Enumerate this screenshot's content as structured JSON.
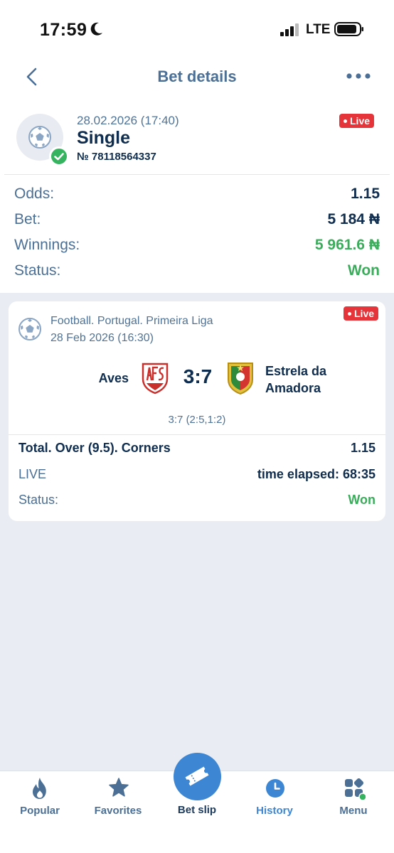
{
  "status_bar": {
    "time": "17:59",
    "network": "LTE"
  },
  "header": {
    "title": "Bet details",
    "back_icon": "chevron-left-icon",
    "more_icon": "more-dots-icon"
  },
  "bet": {
    "datetime": "28.02.2026 (17:40)",
    "type": "Single",
    "number": "№ 78118564337",
    "live_badge": "Live",
    "rows": [
      {
        "label": "Odds:",
        "value": "1.15"
      },
      {
        "label": "Bet:",
        "value": "5 184 ₦"
      },
      {
        "label": "Winnings:",
        "value": "5 961.6 ₦"
      },
      {
        "label": "Status:",
        "value": "Won"
      }
    ]
  },
  "event": {
    "league": "Football. Portugal. Primeira Liga",
    "date": "28 Feb 2026 (16:30)",
    "live_badge": "Live",
    "home_team": "Aves",
    "score": "3:7",
    "away_team": "Estrela da Amadora",
    "score_detail": "3:7 (2:5,1:2)",
    "market": "Total. Over (9.5). Corners",
    "market_odds": "1.15",
    "live_label": "LIVE",
    "time_elapsed": "time elapsed: 68:35",
    "status_label": "Status:",
    "status_value": "Won"
  },
  "nav": {
    "items": [
      {
        "label": "Popular",
        "icon": "flame-icon"
      },
      {
        "label": "Favorites",
        "icon": "star-icon"
      },
      {
        "label": "Bet slip",
        "icon": "ticket-icon"
      },
      {
        "label": "History",
        "icon": "clock-icon"
      },
      {
        "label": "Menu",
        "icon": "grid-icon"
      }
    ]
  },
  "colors": {
    "accent": "#3c86d4",
    "won": "#3aad5b",
    "live": "#e5343a",
    "text_dark": "#0f2d4e",
    "text_muted": "#4b6f95"
  }
}
